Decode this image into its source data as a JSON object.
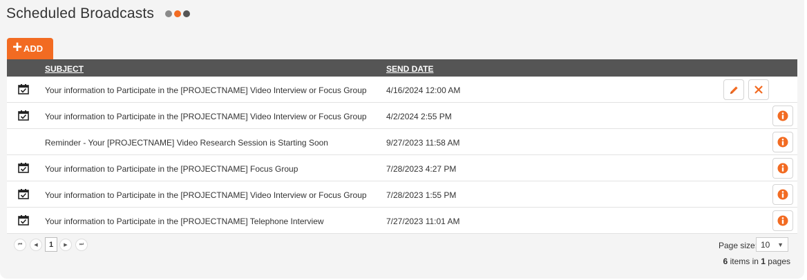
{
  "header": {
    "title": "Scheduled Broadcasts",
    "dots": [
      "#8a8a8a",
      "#f26b22",
      "#555555"
    ]
  },
  "toolbar": {
    "add_label": "ADD"
  },
  "grid": {
    "columns": {
      "subject": "SUBJECT",
      "send_date": "SEND DATE"
    },
    "rows": [
      {
        "has_calendar": true,
        "subject": "Your information to Participate in the [PROJECTNAME] Video Interview or Focus Group",
        "send_date": "4/16/2024 12:00 AM",
        "actions": [
          "edit",
          "delete"
        ]
      },
      {
        "has_calendar": true,
        "subject": "Your information to Participate in the [PROJECTNAME] Video Interview or Focus Group",
        "send_date": "4/2/2024 2:55 PM",
        "actions": [
          "info"
        ]
      },
      {
        "has_calendar": false,
        "subject": "Reminder - Your [PROJECTNAME] Video Research Session is Starting Soon",
        "send_date": "9/27/2023 11:58 AM",
        "actions": [
          "info"
        ]
      },
      {
        "has_calendar": true,
        "subject": "Your information to Participate in the [PROJECTNAME] Focus Group",
        "send_date": "7/28/2023 4:27 PM",
        "actions": [
          "info"
        ]
      },
      {
        "has_calendar": true,
        "subject": "Your information to Participate in the [PROJECTNAME] Video Interview or Focus Group",
        "send_date": "7/28/2023 1:55 PM",
        "actions": [
          "info"
        ]
      },
      {
        "has_calendar": true,
        "subject": "Your information to Participate in the [PROJECTNAME] Telephone Interview",
        "send_date": "7/27/2023 11:01 AM",
        "actions": [
          "info"
        ]
      }
    ]
  },
  "pager": {
    "current_page": "1",
    "page_size_label": "Page size:",
    "page_size": "10",
    "items_count": "6",
    "items_mid": "items in",
    "pages_count": "1",
    "pages_label": "pages"
  },
  "colors": {
    "accent": "#f26b22",
    "header_bg": "#555555"
  }
}
